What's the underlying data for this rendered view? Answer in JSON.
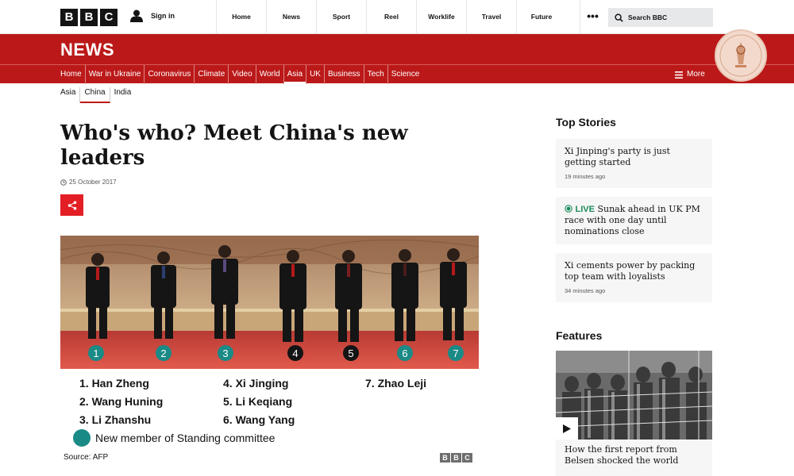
{
  "brand": {
    "logo_letters": [
      "B",
      "B",
      "C"
    ]
  },
  "account": {
    "sign_in": "Sign in"
  },
  "top_nav": [
    "Home",
    "News",
    "Sport",
    "Reel",
    "Worklife",
    "Travel",
    "Future"
  ],
  "search": {
    "placeholder": "Search BBC"
  },
  "section_title": "NEWS",
  "main_nav": [
    "Home",
    "War in Ukraine",
    "Coronavirus",
    "Climate",
    "Video",
    "World",
    "Asia",
    "UK",
    "Business",
    "Tech",
    "Science"
  ],
  "main_nav_active": "Asia",
  "more_label": "More",
  "sub_nav": [
    "Asia",
    "China",
    "India"
  ],
  "sub_nav_active": "China",
  "article": {
    "headline": "Who's who? Meet China's new leaders",
    "date": "25 October 2017"
  },
  "figure": {
    "markers": [
      "1",
      "2",
      "3",
      "4",
      "5",
      "6",
      "7"
    ],
    "names": [
      "1. Han Zheng",
      "2. Wang Huning",
      "3. Li Zhanshu",
      "4. Xi Jinging",
      "5. Li Keqiang",
      "6. Wang Yang",
      "7. Zhao Leji"
    ],
    "legend_note": "New member of Standing committee",
    "source": "Source: AFP",
    "credit_letters": [
      "B",
      "B",
      "C"
    ],
    "colors": {
      "new_member": "#1a8a86",
      "existing_member": "#141414"
    }
  },
  "sidebar": {
    "top_stories_title": "Top Stories",
    "stories": [
      {
        "title": "Xi Jinping's party is just getting started",
        "time": "19 minutes ago",
        "live": false
      },
      {
        "live_label": "LIVE",
        "title": "Sunak ahead in UK PM race with one day until nominations close",
        "live": true
      },
      {
        "title": "Xi cements power by packing top team with loyalists",
        "time": "34 minutes ago",
        "live": false
      }
    ],
    "features_title": "Features",
    "feature": {
      "title": "How the first report from Belsen shocked the world"
    }
  },
  "colors": {
    "brand_red": "#bb1919",
    "share_red": "#e31e25",
    "live_green": "#1a8a5a"
  }
}
